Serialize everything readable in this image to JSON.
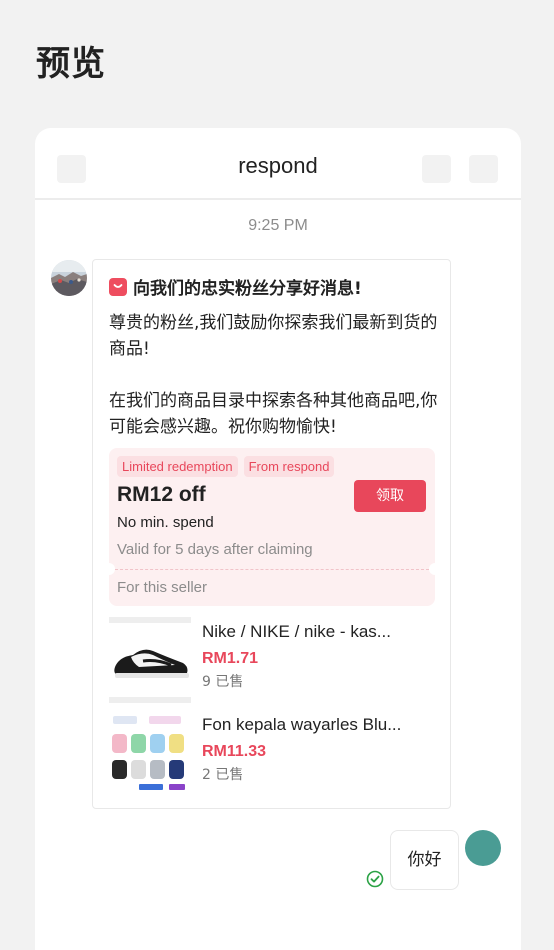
{
  "page": {
    "heading": "预览"
  },
  "chat": {
    "title": "respond",
    "timestamp": "9:25 PM",
    "message": {
      "title": "向我们的忠实粉丝分享好消息!",
      "paragraph_1": "尊贵的粉丝,我们鼓励你探索我们最新到货的商品!",
      "paragraph_2": "在我们的商品目录中探索各种其他商品吧,你可能会感兴趣。祝你购物愉快!"
    },
    "voucher": {
      "tag_1": "Limited redemption",
      "tag_2": "From respond",
      "amount": "RM12 off",
      "min_spend": "No min. spend",
      "validity": "Valid for 5 days after claiming",
      "claim_label": "领取",
      "scope": "For this seller"
    },
    "products": [
      {
        "name": "Nike / NIKE / nike - kas...",
        "price": "RM1.71",
        "sold": "9 已售"
      },
      {
        "name": "Fon kepala wayarles Blu...",
        "price": "RM11.33",
        "sold": "2 已售"
      }
    ],
    "reply": {
      "text": "你好"
    }
  },
  "colors": {
    "accent": "#e8475b",
    "avatar_right": "#4a9c94",
    "check": "#2ba245"
  }
}
